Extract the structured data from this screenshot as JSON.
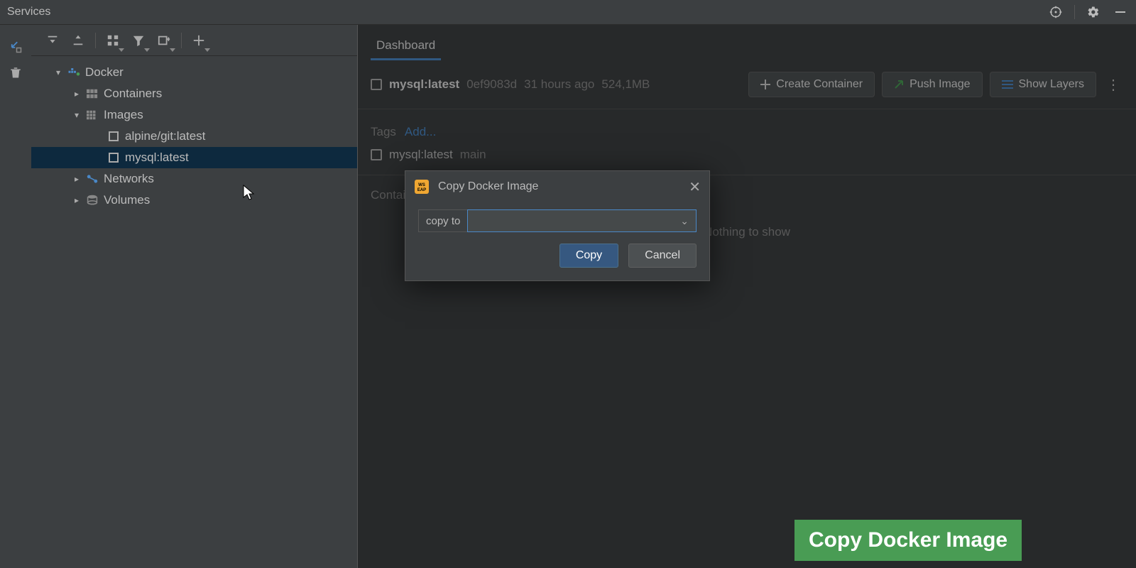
{
  "panel": {
    "title": "Services"
  },
  "tree": {
    "root": {
      "label": "Docker",
      "children": [
        {
          "label": "Containers"
        },
        {
          "label": "Images",
          "children": [
            {
              "label": "alpine/git:latest"
            },
            {
              "label": "mysql:latest",
              "selected": true
            }
          ]
        },
        {
          "label": "Networks"
        },
        {
          "label": "Volumes"
        }
      ]
    }
  },
  "dashboard": {
    "tab_label": "Dashboard",
    "image": {
      "name": "mysql:latest",
      "id": "0ef9083d",
      "age": "31 hours ago",
      "size": "524,1MB"
    },
    "actions": {
      "create_container": "Create Container",
      "push_image": "Push Image",
      "show_layers": "Show Layers"
    },
    "tags": {
      "label": "Tags",
      "add_label": "Add...",
      "items": [
        {
          "name": "mysql:latest",
          "extra": "main"
        }
      ]
    },
    "containers": {
      "label": "Containers",
      "empty_text": "Nothing to show"
    }
  },
  "dialog": {
    "title": "Copy Docker Image",
    "field_label": "copy to",
    "field_value": "",
    "primary": "Copy",
    "cancel": "Cancel"
  },
  "banner": {
    "text": "Copy Docker Image"
  },
  "icons": {
    "compass": "target-icon",
    "gear": "gear-icon",
    "minimize": "minimize-icon"
  }
}
